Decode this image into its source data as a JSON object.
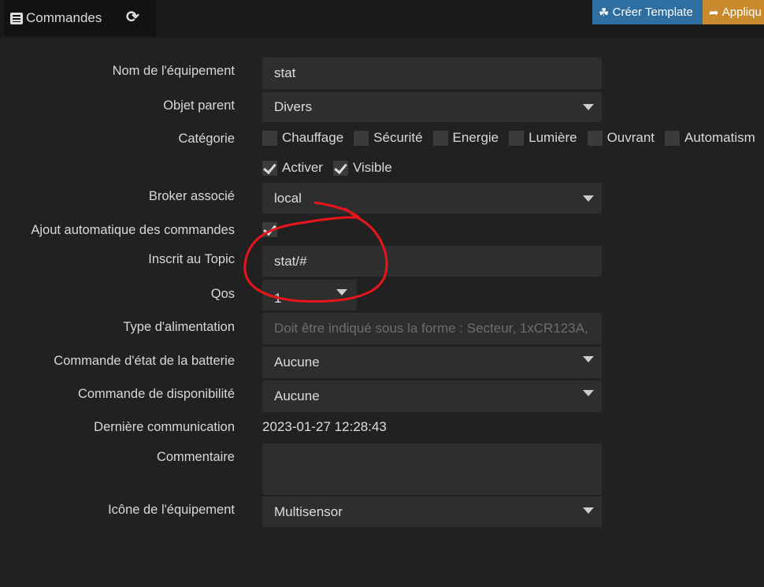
{
  "header": {
    "tab_label": "Commandes",
    "create_template": "Créer Template",
    "apply": "Appliqu"
  },
  "form": {
    "name_label": "Nom de l'équipement",
    "name_value": "stat",
    "parent_label": "Objet parent",
    "parent_value": "Divers",
    "category_label": "Catégorie",
    "categories": [
      "Chauffage",
      "Sécurité",
      "Energie",
      "Lumière",
      "Ouvrant",
      "Automatism"
    ],
    "activer": "Activer",
    "visible": "Visible",
    "broker_label": "Broker associé",
    "broker_value": "local",
    "auto_label": "Ajout automatique des commandes",
    "topic_label": "Inscrit au Topic",
    "topic_value": "stat/#",
    "qos_label": "Qos",
    "qos_value": "1",
    "power_label": "Type d'alimentation",
    "power_placeholder": "Doit être indiqué sous la forme : Secteur, 1xCR123A,",
    "battery_label": "Commande d'état de la batterie",
    "battery_value": "Aucune",
    "avail_label": "Commande de disponibilité",
    "avail_value": "Aucune",
    "lastcomm_label": "Dernière communication",
    "lastcomm_value": "2023-01-27 12:28:43",
    "comment_label": "Commentaire",
    "icon_label": "Icône de l'équipement",
    "icon_value": "Multisensor"
  },
  "annotation_color": "#e8161c"
}
